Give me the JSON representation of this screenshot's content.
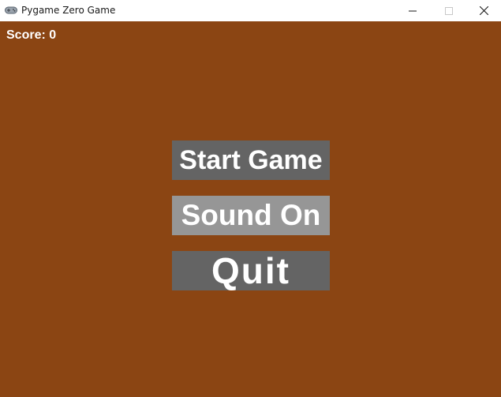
{
  "window": {
    "title": "Pygame Zero Game",
    "icon": "gamepad-icon",
    "controls": [
      "minimize-icon",
      "maximize-icon",
      "close-icon"
    ]
  },
  "game": {
    "background_color": "#8b4513",
    "score_text": "Score: 0",
    "menu": [
      {
        "label": "Start Game",
        "color": "#646464"
      },
      {
        "label": "Sound On",
        "color": "#969696"
      },
      {
        "label": "Quit",
        "color": "#646464"
      }
    ]
  }
}
